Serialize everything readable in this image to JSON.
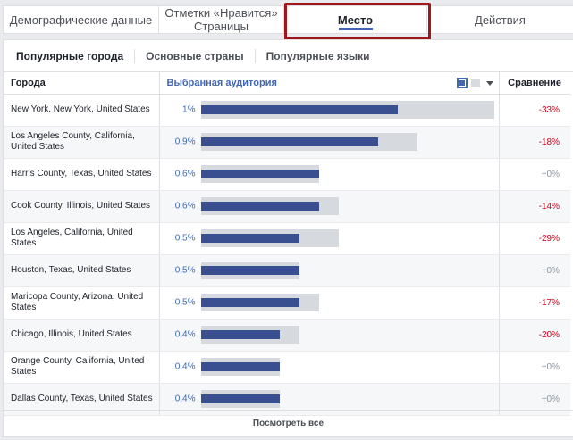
{
  "top_tabs": [
    {
      "label": "Демографические данные"
    },
    {
      "label": "Отметки «Нравится» Страницы"
    },
    {
      "label": "Место"
    },
    {
      "label": "Действия"
    }
  ],
  "sub_tabs": [
    {
      "label": "Популярные города"
    },
    {
      "label": "Основные страны"
    },
    {
      "label": "Популярные языки"
    }
  ],
  "table": {
    "col_city": "Города",
    "col_audience": "Выбранная аудитория",
    "col_compare": "Сравнение",
    "rows": [
      {
        "city": "New York, New York, United States",
        "pct": "1%",
        "value": 1.0,
        "baseline": 1.49,
        "compare": "-33%",
        "trend": "neg"
      },
      {
        "city": "Los Angeles County, California, United States",
        "pct": "0,9%",
        "value": 0.9,
        "baseline": 1.1,
        "compare": "-18%",
        "trend": "neg"
      },
      {
        "city": "Harris County, Texas, United States",
        "pct": "0,6%",
        "value": 0.6,
        "baseline": 0.6,
        "compare": "+0%",
        "trend": "zero"
      },
      {
        "city": "Cook County, Illinois, United States",
        "pct": "0,6%",
        "value": 0.6,
        "baseline": 0.7,
        "compare": "-14%",
        "trend": "neg"
      },
      {
        "city": "Los Angeles, California, United States",
        "pct": "0,5%",
        "value": 0.5,
        "baseline": 0.7,
        "compare": "-29%",
        "trend": "neg"
      },
      {
        "city": "Houston, Texas, United States",
        "pct": "0,5%",
        "value": 0.5,
        "baseline": 0.5,
        "compare": "+0%",
        "trend": "zero"
      },
      {
        "city": "Maricopa County, Arizona, United States",
        "pct": "0,5%",
        "value": 0.5,
        "baseline": 0.6,
        "compare": "-17%",
        "trend": "neg"
      },
      {
        "city": "Chicago, Illinois, United States",
        "pct": "0,4%",
        "value": 0.4,
        "baseline": 0.5,
        "compare": "-20%",
        "trend": "neg"
      },
      {
        "city": "Orange County, California, United States",
        "pct": "0,4%",
        "value": 0.4,
        "baseline": 0.4,
        "compare": "+0%",
        "trend": "zero"
      },
      {
        "city": "Dallas County, Texas, United States",
        "pct": "0,4%",
        "value": 0.4,
        "baseline": 0.4,
        "compare": "+0%",
        "trend": "zero"
      }
    ]
  },
  "footer": {
    "see_all": "Посмотреть все"
  },
  "colors": {
    "accent": "#4267b2",
    "bar": "#3a4f8f",
    "negative": "#d0021b",
    "highlight": "#a0171b"
  }
}
